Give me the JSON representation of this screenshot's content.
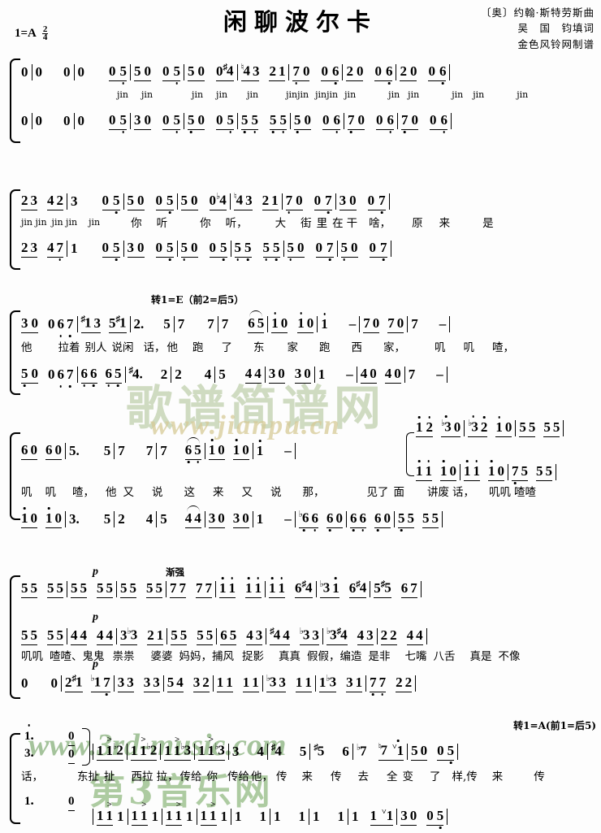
{
  "header": {
    "title": "闲聊波尔卡",
    "key": "1=A",
    "meter_num": "2",
    "meter_den": "4",
    "credit_composer": "〔奥〕约翰·斯特劳斯曲",
    "credit_lyricist": "吴　国　钧填词",
    "credit_engraver": "金色风铃网制谱"
  },
  "markings": {
    "mod_e": "转1=E（前2=后5）",
    "mod_a": "转1=A(前1=后5)",
    "p": "p",
    "cresc": "渐强"
  },
  "watermarks": {
    "w1": "歌谱简谱网",
    "w2": "www.jianpu.cn",
    "w3": "www.3rd-music.com",
    "w4": "第3音乐网"
  },
  "systems": [
    {
      "id": "system-1",
      "voice1": "0 | 0   0 | 0   0 5̣ | 5 0  0 5̣ | 5 0  0♯4 | ♮4 3  2 1 | 7̣ 0  0 6̣ | 2 0  0 6̣ | 2 0  0 6̣ |",
      "lyrics": "jin   jin      jin  jin  jin    jin jin  jin jin   jin        jin    jin       jin    jin       jin",
      "voice2": "0 | 0   0 | 0   0 5̣ | 3 0  0 5̣ | 5̣ 0  0 5̣ | 5̣ 5̣  5̣ 5̣ | 5̣ 0  0 6̣ | 7̣ 0  0 6̣ | 7̣ 0  0 6̣ |"
    },
    {
      "id": "system-2",
      "voice1": "2 3  4 2 | 3   0 5̣ | 5 0  0 5̣ | 5 0  0♭4 | ♮4 3  2 1 | 7̣ 0  0 7̣ | 3 0  0 7̣ |",
      "lyrics": "jin jin  jin jin  jin      你  听     你  听，   大  街 里 在 干  啥，      原  来      是",
      "voice2": "2 3  4 7̣ | 1   0 5̣ | 3 0  0 5̣ | 5̣ 0  0 5̣ | 5̣ 5̣  5̣ 5̣ | 5̣ 0  0 7̣ | 5̣ 0  0 7̣ |"
    },
    {
      "id": "system-3",
      "voice1": "3 0  0 6 7 | ♯1 3  5♯1 | 2.  5 | 7   7 | 7   6 5 | 1̇ 0  1̇ 0 | 1̇  - | 7 0  7 0 | 7  - |",
      "lyrics": "他    拉着  别人 说闲  话， 他  跑   了   东  家  跑  西  家，      叽  叽   喳，",
      "voice2": "5̣ 0  0 6 7 | 6̣ 6̣  6̣ 5̣ | ♯4.  2 | 2   4 | 5   4 4 | 3 0  3 0 | 1  - | 4 0  4 0 | 7  - |"
    },
    {
      "id": "system-4",
      "voice1": "6 0  6 0 | 5.   5 | 7   7 | 7   6 5 | 1̇ 0  1̇ 0 | 1̇  - | 1̇ 2̇ ♭3̇ 0 | ♭3̇ 2̇  1̇ 0 | 5 5  5 5 |",
      "voice1b": "1̇ 1̇  1̇ 0 | 1̇ 1̇  1̇ 0 | 7̣ 5  5 5 |",
      "lyrics": "叽  叽   喳，  他 又  说  这 来  又  说   那，        见了 面    讲废 话，  叽叽 喳喳",
      "voice2": "1̇ 0  1̇ 0 | 3.   5 | 2   4 | 5   4 4 | 3 0  3 0 | 1  - | ♭6 6  6 0 | 6 6  6 0 | 5 5  5 5 |"
    },
    {
      "id": "system-5",
      "voice1": "5 5  5 5 | 5 5  5 5 | 5 5  5 5 | 7 7  7 7 | 1̇ 1̇  1̇ 1̇ | 1̇ 1̇  6♯4 | ♭3 1̇  6♯4 | 5♯5  6 7 |",
      "voice2": "5 5  5 5 | 4 4  4 4 | 3♭3  2 1 | 5 5  5 5 | 6 5  4 3 | ♯4 4  ♭3 3 | ♭3♯4  4 3 | 2 2  4 4 |",
      "lyrics": "叽叽 喳喳、鬼鬼 祟祟  婆婆 妈妈，捕风 捉影  真真 假假，编造 是非  七嘴 八舌  真是 不像",
      "voice3": "0   0 | 2♯1 ♭1 7̣ | 3 3  3 3 | 5 4  3 2 | 1 1  1 1 | ♭3 3  1 1 | 1♭3  3 1 | 7̣ 7̣  2 2 |"
    },
    {
      "id": "system-6",
      "ending1": "1̇.",
      "ending3": "3.",
      "ending_low": "1.",
      "voice1": "0 ) | 1 1 ♭2 | 1 1  ♭2 | 1 1  ♭3 | 1 1  ♭3 | 3   4 | ♯4   5 | ♯5   6 | ♭7  ♮7 ˅1̇ | 5 0  0 5̣ |",
      "lyrics": "话，      东扯 扯   西拉 拉，传给 你  传给 他， 传  来  传  去  全 变  了  样,传  来    传",
      "voice2": "1.   0 | 1 1  1 | 1 1  1 | 1 1  1 | 1 1  1 | 1   1 | 1   1 | 1  1 | 1  1 ˅1 | 3 0  0 5̣ |"
    }
  ]
}
